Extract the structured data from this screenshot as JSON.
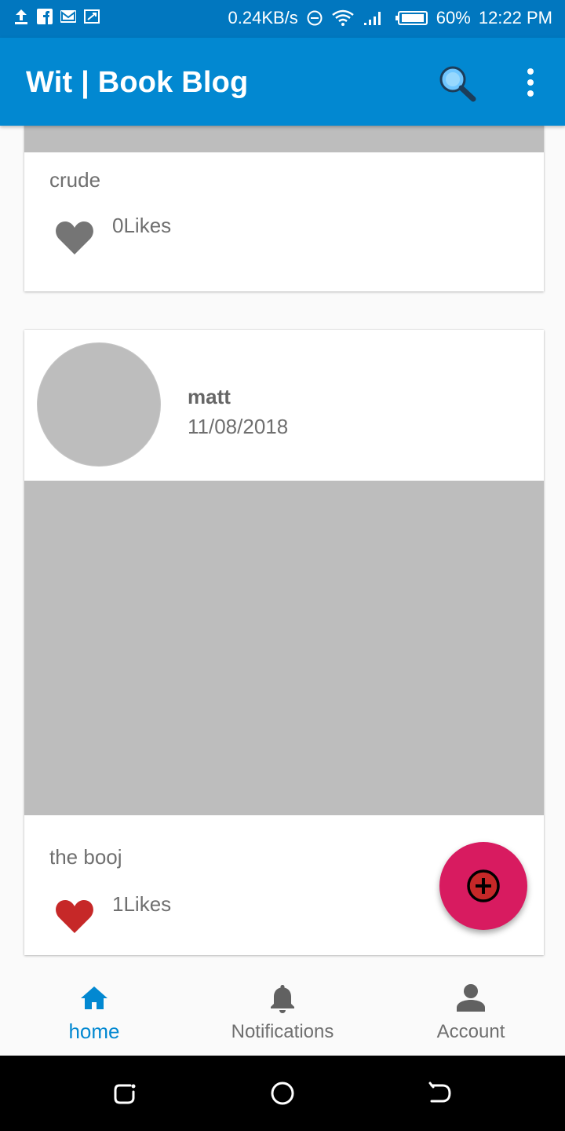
{
  "status_bar": {
    "speed": "0.24KB/s",
    "battery": "60%",
    "time": "12:22 PM"
  },
  "app_bar": {
    "title": "Wit | Book Blog"
  },
  "posts": [
    {
      "caption": "crude",
      "likes": "0Likes",
      "liked": false
    },
    {
      "author": "matt",
      "date": "11/08/2018",
      "caption": "the booj",
      "likes": "1Likes",
      "liked": true
    }
  ],
  "bottom_nav": {
    "items": [
      {
        "label": "home",
        "icon": "home-icon",
        "active": true
      },
      {
        "label": "Notifications",
        "icon": "bell-icon",
        "active": false
      },
      {
        "label": "Account",
        "icon": "person-icon",
        "active": false
      }
    ]
  },
  "colors": {
    "primary": "#0288d1",
    "status_bar": "#0177bf",
    "accent": "#d81b60",
    "liked_heart": "#c62828",
    "unliked_heart": "#757575",
    "placeholder": "#bdbdbd"
  }
}
